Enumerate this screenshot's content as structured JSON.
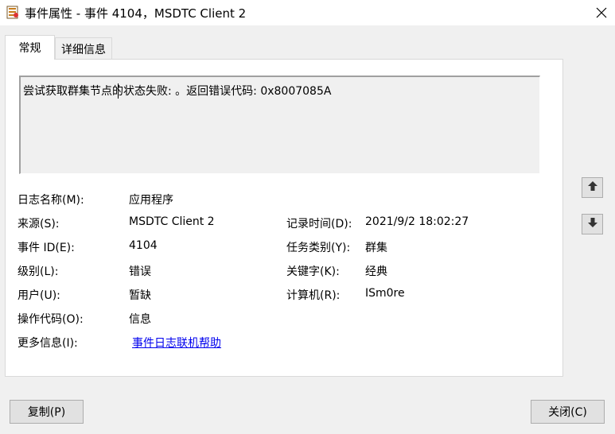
{
  "window": {
    "title": "事件属性 - 事件 4104，MSDTC Client 2",
    "icon": "event-viewer-icon",
    "close_icon": "close-icon"
  },
  "tabs": [
    {
      "label": "常规",
      "active": true
    },
    {
      "label": "详细信息",
      "active": false
    }
  ],
  "description": "尝试获取群集节点的状态失败: 。返回错误代码: 0x8007085A",
  "fields": {
    "log_name": {
      "label": "日志名称(M):",
      "value": "应用程序"
    },
    "source": {
      "label": "来源(S):",
      "value": "MSDTC Client 2"
    },
    "logged": {
      "label": "记录时间(D):",
      "value": "2021/9/2 18:02:27"
    },
    "event_id": {
      "label": "事件 ID(E):",
      "value": "4104"
    },
    "task_category": {
      "label": "任务类别(Y):",
      "value": "群集"
    },
    "level": {
      "label": "级别(L):",
      "value": "错误"
    },
    "keywords": {
      "label": "关键字(K):",
      "value": "经典"
    },
    "user": {
      "label": "用户(U):",
      "value": "暂缺"
    },
    "computer": {
      "label": "计算机(R):",
      "value": "ISm0re"
    },
    "opcode": {
      "label": "操作代码(O):",
      "value": "信息"
    },
    "more_info": {
      "label": "更多信息(I):",
      "value": "事件日志联机帮助"
    }
  },
  "nav": {
    "up_icon": "arrow-up-icon",
    "down_icon": "arrow-down-icon"
  },
  "buttons": {
    "copy": "复制(P)",
    "close": "关闭(C)"
  }
}
